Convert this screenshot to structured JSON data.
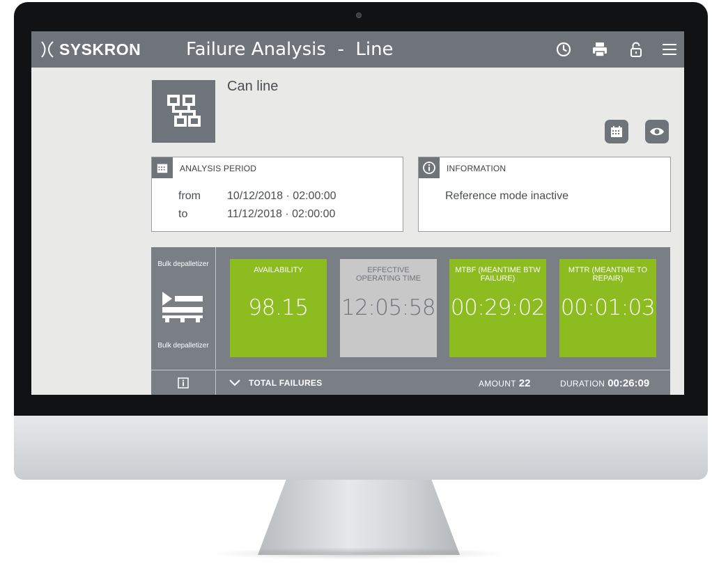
{
  "header": {
    "brand": "SYSKRON",
    "title": "Failure Analysis  -  Line",
    "icons": [
      "clock-icon",
      "printer-icon",
      "unlock-icon",
      "menu-icon"
    ]
  },
  "line": {
    "name": "Can line",
    "icon": "line-structure-icon",
    "actions": [
      "calendar-icon",
      "eye-icon"
    ]
  },
  "analysis_period": {
    "title": "ANALYSIS PERIOD",
    "from_label": "from",
    "from_value": "10/12/2018 · 02:00:00",
    "to_label": "to",
    "to_value": "11/12/2018 · 02:00:00"
  },
  "information": {
    "title": "INFORMATION",
    "text": "Reference mode inactive"
  },
  "machine": {
    "name_top": "Bulk depalletizer",
    "name_bottom": "Bulk depalletizer",
    "icon": "depalletizer-icon",
    "kpis": [
      {
        "label": "AVAILABILITY",
        "value": "98.15",
        "color": "#8cbc1f"
      },
      {
        "label": "EFFECTIVE OPERATING TIME",
        "value": "12:05:58",
        "color": "#c8c8c8"
      },
      {
        "label": "MTBF (MEANTIME BTW FAILURE)",
        "value": "00:29:02",
        "color": "#8cbc1f"
      },
      {
        "label": "MTTR (MEANTIME TO REPAIR)",
        "value": "00:01:03",
        "color": "#8cbc1f"
      }
    ]
  },
  "failures": {
    "title": "TOTAL FAILURES",
    "amount_label": "AMOUNT",
    "amount_value": "22",
    "duration_label": "DURATION",
    "duration_value": "00:26:09"
  },
  "colors": {
    "header_bg": "#6f737a",
    "accent_green": "#8cbc1f",
    "neutral_kpi": "#c8c8c8",
    "machine_bg": "#7a7e85"
  }
}
